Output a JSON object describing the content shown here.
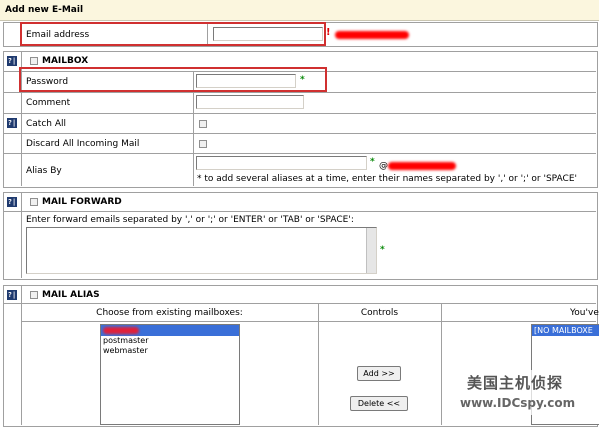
{
  "header": {
    "title": "Add new E-Mail"
  },
  "email": {
    "label": "Email address",
    "value": "",
    "required_mark": "!"
  },
  "mailbox": {
    "section_title": "MAILBOX",
    "help_icon": "?|",
    "password_label": "Password",
    "password_value": "",
    "required_mark": "*",
    "comment_label": "Comment",
    "comment_value": "",
    "catch_all_label": "Catch All",
    "discard_label": "Discard All Incoming Mail",
    "alias_label": "Alias By",
    "alias_value": "",
    "alias_at": "@",
    "alias_hint": "* to add several aliases at a time, enter their names separated by ',' or ';' or 'SPACE'"
  },
  "forward": {
    "section_title": "MAIL FORWARD",
    "instructions": "Enter forward emails separated by ',' or ';' or 'ENTER' or 'TAB' or 'SPACE':",
    "value": "",
    "required_mark": "*"
  },
  "alias": {
    "section_title": "MAIL ALIAS",
    "col_choose": "Choose from existing mailboxes:",
    "col_controls": "Controls",
    "col_selected": "You've",
    "existing_mailboxes": [
      "",
      "postmaster",
      "webmaster"
    ],
    "selected_list": [
      "[NO MAILBOXE"
    ],
    "add_button": "Add >>",
    "delete_button": "Delete <<"
  },
  "watermark": {
    "line1": "美国主机侦探",
    "line2": "www.IDCspy.com"
  },
  "colors": {
    "header_bg": "#fbf6de",
    "accent_green": "#0a8a0a",
    "highlight": "#d03030",
    "selection": "#3a6fd8"
  }
}
